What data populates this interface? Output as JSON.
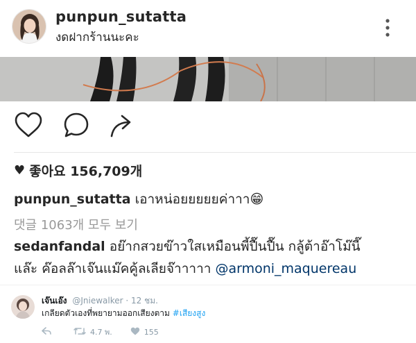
{
  "post": {
    "username": "punpun_sutatta",
    "location": "งดฝากร้านนะคะ",
    "likes_label": "좋아요 156,709개",
    "caption": {
      "user": "punpun_sutatta",
      "text": "เอาหน่อยยยยยค่าาา",
      "emoji": "😁"
    },
    "view_all_comments": "댓글 1063개 모두 보기",
    "comment": {
      "user": "sedanfandal",
      "line1": "อย๊ากสวยข๊าวใสเหมือนพี้ปื๊นปื๊น กลู้ต้าอ๊าโม๊นี๊",
      "line2_prefix": "แล๊ะ ค๊อลล๊าเจ๊นแม๊คคู้ลเลียจ๊าาาาา",
      "mention": "@armoni_maquereau"
    }
  },
  "tweet": {
    "display_name": "เจ๊นเอ๊ง",
    "handle": "@Jniewalker",
    "time": "· 12 ชม.",
    "text": "เกลียดตัวเองที่พยายามออกเสียงตาม",
    "hashtag": "#เสียงสูง",
    "retweets": "4.7 พ.",
    "likes": "155"
  },
  "icons": [
    "more-vertical-icon",
    "heart-outline-icon",
    "comment-bubble-icon",
    "share-arrow-icon",
    "heart-filled-icon",
    "reply-icon",
    "retweet-icon",
    "like-icon"
  ]
}
